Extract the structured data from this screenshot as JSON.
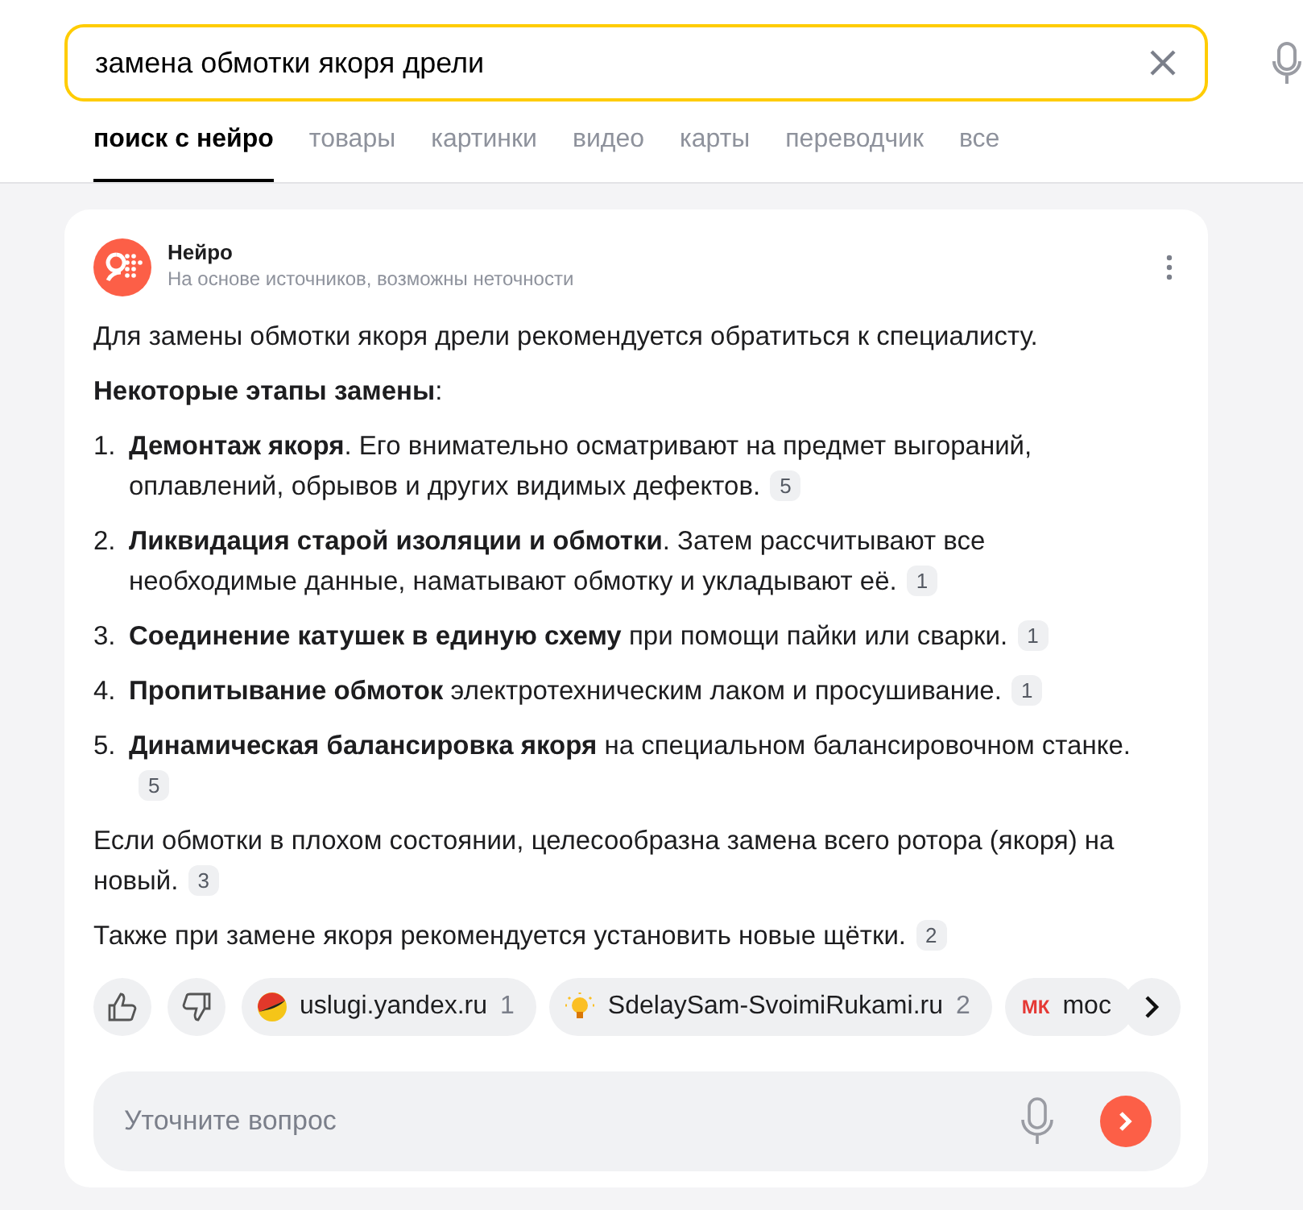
{
  "search": {
    "value": "замена обмотки якоря дрели"
  },
  "tabs": [
    {
      "label": "поиск с нейро",
      "selected": true
    },
    {
      "label": "товары",
      "selected": false
    },
    {
      "label": "картинки",
      "selected": false
    },
    {
      "label": "видео",
      "selected": false
    },
    {
      "label": "карты",
      "selected": false
    },
    {
      "label": "переводчик",
      "selected": false
    },
    {
      "label": "все",
      "selected": false
    }
  ],
  "answer": {
    "title": "Нейро",
    "subtitle": "На основе источников, возможны неточности",
    "intro": "Для замены обмотки якоря дрели рекомендуется обратиться к специалисту.",
    "heading": "**Некоторые этапы замены**:",
    "steps": [
      {
        "number": "1.",
        "text": "**Демонтаж якоря**. Его внимательно осматривают на предмет выгораний, оплавлений, обрывов и других видимых дефектов.",
        "ref": "5"
      },
      {
        "number": "2.",
        "text": "**Ликвидация старой изоляции и обмотки**. Затем рассчитывают все необходимые данные, наматывают обмотку и укладывают её.",
        "ref": "1"
      },
      {
        "number": "3.",
        "text": "**Соединение катушек в единую схему** при помощи пайки или сварки.",
        "ref": "1"
      },
      {
        "number": "4.",
        "text": "**Пропитывание обмоток** электротехническим лаком и просушивание.",
        "ref": "1"
      },
      {
        "number": "5.",
        "text": "**Динамическая балансировка якоря** на специальном балансировочном станке.",
        "ref": "5"
      }
    ],
    "paragraphs": [
      {
        "text": "Если обмотки в плохом состоянии, целесообразна замена всего ротора (якоря) на новый.",
        "ref": "3"
      },
      {
        "text": "Также при замене якоря рекомендуется установить новые щётки.",
        "ref": "2"
      }
    ]
  },
  "sources": [
    {
      "kind": "sphere",
      "label": "uslugi.yandex.ru",
      "count": "1"
    },
    {
      "kind": "bulb",
      "label": "SdelaySam-SvoimiRukami.ru",
      "count": "2"
    },
    {
      "kind": "mark",
      "mark": "МК",
      "label": "moc"
    }
  ],
  "followup": {
    "placeholder": "Уточните вопрос"
  }
}
